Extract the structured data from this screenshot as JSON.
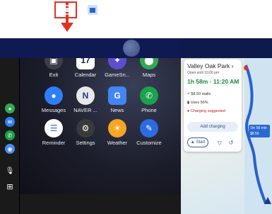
{
  "topbar": {
    "back_icon": "back-arrow-icon",
    "home_icon": "home-icon",
    "window_icon": "split-window-icon",
    "folder_icon": "folder-icon"
  },
  "apps": [
    {
      "label": "Exit",
      "icon": "exit-icon",
      "color": "#3b3f4a",
      "glyph": "▣"
    },
    {
      "label": "Calendar",
      "icon": "calendar-icon",
      "color": "#ffffff",
      "glyph": "17"
    },
    {
      "label": "GameSn...",
      "icon": "game-icon",
      "color": "#5a4fd0",
      "glyph": "✦"
    },
    {
      "label": "Maps",
      "icon": "maps-icon",
      "color": "#34a853",
      "glyph": "⬤"
    },
    {
      "label": "Messages",
      "icon": "messages-icon",
      "color": "#2d7ff9",
      "glyph": "💬"
    },
    {
      "label": "NAVER ...",
      "icon": "naver-map-icon",
      "color": "#e8e8e8",
      "glyph": "N"
    },
    {
      "label": "News",
      "icon": "news-icon",
      "color": "#4285f4",
      "glyph": "G"
    },
    {
      "label": "Phone",
      "icon": "phone-icon",
      "color": "#1aa34a",
      "glyph": "✆"
    },
    {
      "label": "Reminder",
      "icon": "reminder-icon",
      "color": "#ffffff",
      "glyph": "☰"
    },
    {
      "label": "Settings",
      "icon": "settings-icon",
      "color": "#3a3a3a",
      "glyph": "⚙"
    },
    {
      "label": "Weather",
      "icon": "weather-icon",
      "color": "#f5a623",
      "glyph": "☀"
    },
    {
      "label": "Customize",
      "icon": "customize-icon",
      "color": "#2d6be0",
      "glyph": "✎"
    }
  ],
  "dock": [
    {
      "icon": "maps-icon",
      "color": "#34a853"
    },
    {
      "icon": "messages-icon",
      "color": "#2d7ff9"
    },
    {
      "icon": "phone-icon",
      "color": "#1aa34a"
    },
    {
      "icon": "google-maps-icon",
      "color": "#4a8af4"
    },
    {
      "icon": "microphone-icon",
      "color": "#1a1a1a"
    },
    {
      "icon": "app-grid-icon",
      "color": "#1a1a1a"
    }
  ],
  "map": {
    "title": "Valley Oak Park",
    "hours": "Open until 10:00 pm",
    "eta": "1h 58m · 11:20 AM",
    "stalls": "$8.50 stalls",
    "usage": "Uses 56%",
    "charging": "Charging suggested",
    "add_charging_label": "Add charging",
    "start_label": "Start",
    "badge_line1": "1hr 58 min",
    "badge_line2": "$8.50"
  }
}
